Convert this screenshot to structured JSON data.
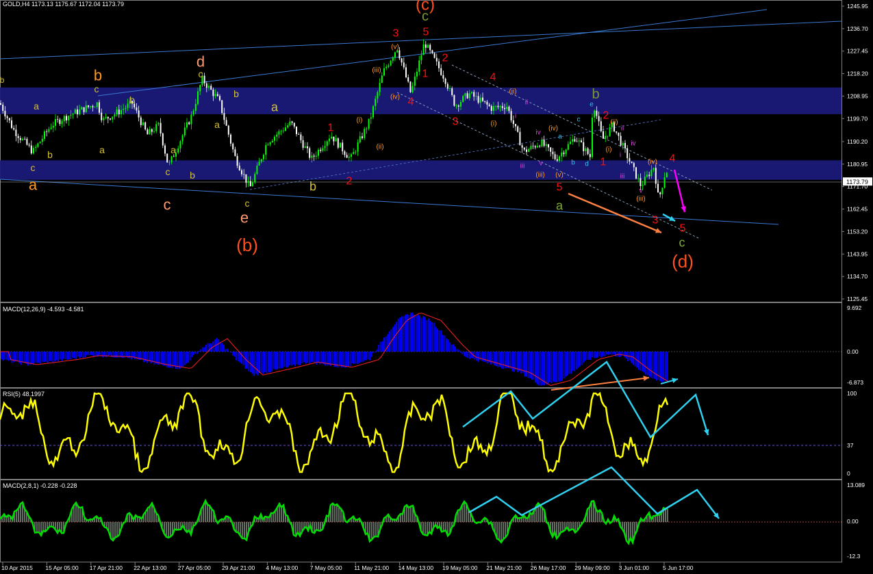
{
  "colors": {
    "background": "#000000",
    "bull_candle": "#00ff00",
    "bear_candle": "#ffffff",
    "zone": "#1a1a7a",
    "channel": "#3a7bd5",
    "macd_hist": "#0000ff",
    "macd_signal": "#ff2020",
    "rsi_line": "#ffff00",
    "macd2_line": "#00dd00",
    "macd2_hist": "#7a8a7a",
    "cyan": "#30d0f0",
    "orange": "#ff8040",
    "magenta": "#ff00ff",
    "level": "#6a5acd"
  },
  "main": {
    "title": "GOLD,H4  1173.13  1175.67  1172.04  1173.79",
    "current_price": "1173.79",
    "price_ticks": [
      "1245.95",
      "1236.70",
      "1227.45",
      "1218.20",
      "1208.95",
      "1199.70",
      "1190.20",
      "1180.95",
      "1171.70",
      "1162.45",
      "1153.20",
      "1143.95",
      "1134.70",
      "1125.45"
    ]
  },
  "macd1": {
    "title": "MACD(12,26,9) -4.593 -4.581",
    "ticks": [
      "9.692",
      "0.00",
      "-6.873"
    ]
  },
  "rsi": {
    "title": "RSI(5) 48.1997",
    "ticks": [
      "100",
      "37",
      "0"
    ]
  },
  "macd2": {
    "title": "MACD(2,8,1) -0.228 -0.228",
    "ticks": [
      "13.089",
      "0.00",
      "-12.3"
    ]
  },
  "time_labels": [
    "10 Apr 2015",
    "15 Apr 05:00",
    "17 Apr 21:00",
    "22 Apr 13:00",
    "27 Apr 05:00",
    "29 Apr 21:00",
    "4 May 13:00",
    "7 May 05:00",
    "11 May 21:00",
    "14 May 13:00",
    "19 May 05:00",
    "21 May 21:00",
    "26 May 17:00",
    "29 May 09:00",
    "3 Jun 01:00",
    "5 Jun 17:00"
  ],
  "chart_data": {
    "type": "line",
    "symbol": "GOLD",
    "timeframe": "H4",
    "ylim": [
      1125.45,
      1245.95
    ],
    "x": [
      "10 Apr 2015",
      "15 Apr 05:00",
      "17 Apr 21:00",
      "22 Apr 13:00",
      "27 Apr 05:00",
      "29 Apr 21:00",
      "4 May 13:00",
      "7 May 05:00",
      "11 May 21:00",
      "14 May 13:00",
      "19 May 05:00",
      "21 May 21:00",
      "26 May 17:00",
      "29 May 09:00",
      "3 Jun 01:00",
      "5 Jun 17:00"
    ],
    "close_approx": [
      1207,
      1199,
      1208,
      1181,
      1213,
      1181,
      1196,
      1189,
      1215,
      1226,
      1205,
      1199,
      1185,
      1190,
      1177,
      1173.79
    ],
    "ohlc_last": {
      "open": 1173.13,
      "high": 1175.67,
      "low": 1172.04,
      "close": 1173.79
    },
    "zones": [
      [
        1201.5,
        1212.5
      ],
      [
        1174.5,
        1182.5
      ]
    ],
    "wave_labels": [
      {
        "t": "b",
        "c": "#d4c030",
        "x": 3,
        "y": 117,
        "s": 12
      },
      {
        "t": "b",
        "c": "#ff9a20",
        "x": 143,
        "y": 110,
        "s": 22
      },
      {
        "t": "c",
        "c": "#d4c030",
        "x": 141,
        "y": 130,
        "s": 14
      },
      {
        "t": "a",
        "c": "#d4c030",
        "x": 53,
        "y": 155,
        "s": 14
      },
      {
        "t": "c",
        "c": "#d4c030",
        "x": 48,
        "y": 245,
        "s": 14
      },
      {
        "t": "b",
        "c": "#d4c030",
        "x": 73,
        "y": 226,
        "s": 14
      },
      {
        "t": "a",
        "c": "#ff9a20",
        "x": 48,
        "y": 270,
        "s": 22
      },
      {
        "t": "a",
        "c": "#d4c030",
        "x": 149,
        "y": 219,
        "s": 14
      },
      {
        "t": "b",
        "c": "#d4c030",
        "x": 193,
        "y": 146,
        "s": 14
      },
      {
        "t": "a",
        "c": "#d4c030",
        "x": 253,
        "y": 219,
        "s": 14
      },
      {
        "t": "c",
        "c": "#d4c030",
        "x": 245,
        "y": 251,
        "s": 14
      },
      {
        "t": "b",
        "c": "#d4c030",
        "x": 281,
        "y": 256,
        "s": 14
      },
      {
        "t": "c",
        "c": "#ff9a70",
        "x": 244,
        "y": 299,
        "s": 22
      },
      {
        "t": "d",
        "c": "#ff9a70",
        "x": 293,
        "y": 90,
        "s": 22
      },
      {
        "t": "c",
        "c": "#d4c030",
        "x": 293,
        "y": 108,
        "s": 14
      },
      {
        "t": "a",
        "c": "#d4c030",
        "x": 317,
        "y": 182,
        "s": 14
      },
      {
        "t": "b",
        "c": "#d4c030",
        "x": 345,
        "y": 137,
        "s": 14
      },
      {
        "t": "c",
        "c": "#d4c030",
        "x": 361,
        "y": 297,
        "s": 14
      },
      {
        "t": "e",
        "c": "#ff9a70",
        "x": 357,
        "y": 318,
        "s": 22
      },
      {
        "t": "(b)",
        "c": "#ff5020",
        "x": 361,
        "y": 358,
        "s": 26
      },
      {
        "t": "a",
        "c": "#d4c030",
        "x": 401,
        "y": 156,
        "s": 18
      },
      {
        "t": "b",
        "c": "#d4c030",
        "x": 457,
        "y": 272,
        "s": 18
      },
      {
        "t": "1",
        "c": "#ff1010",
        "x": 483,
        "y": 186,
        "s": 16
      },
      {
        "t": "2",
        "c": "#ff1010",
        "x": 510,
        "y": 264,
        "s": 16
      },
      {
        "t": "(i)",
        "c": "#ff9a20",
        "x": 525,
        "y": 175,
        "s": 10
      },
      {
        "t": "(ii)",
        "c": "#ff9a20",
        "x": 555,
        "y": 214,
        "s": 10
      },
      {
        "t": "(iii)",
        "c": "#ff9a20",
        "x": 550,
        "y": 102,
        "s": 10
      },
      {
        "t": "(iv)",
        "c": "#ff9a20",
        "x": 577,
        "y": 141,
        "s": 10
      },
      {
        "t": "(v)",
        "c": "#ff9a20",
        "x": 577,
        "y": 68,
        "s": 10
      },
      {
        "t": "3",
        "c": "#ff1010",
        "x": 578,
        "y": 48,
        "s": 16
      },
      {
        "t": "4",
        "c": "#ff1010",
        "x": 600,
        "y": 148,
        "s": 16
      },
      {
        "t": "5",
        "c": "#ff1010",
        "x": 622,
        "y": 46,
        "s": 16
      },
      {
        "t": "1",
        "c": "#ff1010",
        "x": 621,
        "y": 107,
        "s": 16
      },
      {
        "t": "2",
        "c": "#ff1010",
        "x": 650,
        "y": 84,
        "s": 16
      },
      {
        "t": "(c)",
        "c": "#ff5020",
        "x": 621,
        "y": 6,
        "s": 24
      },
      {
        "t": "c",
        "c": "#7a9a30",
        "x": 621,
        "y": 23,
        "s": 20
      },
      {
        "t": "3",
        "c": "#ff1010",
        "x": 665,
        "y": 177,
        "s": 16
      },
      {
        "t": "4",
        "c": "#ff1010",
        "x": 720,
        "y": 112,
        "s": 16
      },
      {
        "t": "(ii)",
        "c": "#ff9a20",
        "x": 749,
        "y": 133,
        "s": 10
      },
      {
        "t": "(i)",
        "c": "#ff9a20",
        "x": 721,
        "y": 180,
        "s": 10
      },
      {
        "t": "i",
        "c": "#dd44dd",
        "x": 753,
        "y": 169,
        "s": 10
      },
      {
        "t": "ii",
        "c": "#dd44dd",
        "x": 769,
        "y": 149,
        "s": 10
      },
      {
        "t": "iv",
        "c": "#dd44dd",
        "x": 786,
        "y": 193,
        "s": 10
      },
      {
        "t": "iii",
        "c": "#dd44dd",
        "x": 763,
        "y": 242,
        "s": 10
      },
      {
        "t": "v",
        "c": "#dd44dd",
        "x": 790,
        "y": 238,
        "s": 10
      },
      {
        "t": "(iv)",
        "c": "#ff9a20",
        "x": 808,
        "y": 187,
        "s": 10
      },
      {
        "t": "(iii)",
        "c": "#ff9a20",
        "x": 789,
        "y": 255,
        "s": 10
      },
      {
        "t": "(v)",
        "c": "#ff9a20",
        "x": 817,
        "y": 255,
        "s": 10
      },
      {
        "t": "a",
        "c": "#30c0f0",
        "x": 818,
        "y": 199,
        "s": 10
      },
      {
        "t": "b",
        "c": "#30c0f0",
        "x": 837,
        "y": 237,
        "s": 10
      },
      {
        "t": "c",
        "c": "#30c0f0",
        "x": 845,
        "y": 174,
        "s": 10
      },
      {
        "t": "d",
        "c": "#30c0f0",
        "x": 857,
        "y": 239,
        "s": 10
      },
      {
        "t": "e",
        "c": "#30c0f0",
        "x": 864,
        "y": 152,
        "s": 10
      },
      {
        "t": "5",
        "c": "#ff1010",
        "x": 817,
        "y": 273,
        "s": 16
      },
      {
        "t": "a",
        "c": "#7ab030",
        "x": 817,
        "y": 300,
        "s": 18
      },
      {
        "t": "b",
        "c": "#7a9a30",
        "x": 870,
        "y": 137,
        "s": 20
      },
      {
        "t": "2",
        "c": "#ff1010",
        "x": 885,
        "y": 168,
        "s": 16
      },
      {
        "t": "1",
        "c": "#ff1010",
        "x": 881,
        "y": 236,
        "s": 16
      },
      {
        "t": "(ii)",
        "c": "#ff9a20",
        "x": 897,
        "y": 178,
        "s": 10
      },
      {
        "t": "(i)",
        "c": "#ff9a20",
        "x": 889,
        "y": 218,
        "s": 10
      },
      {
        "t": "ii",
        "c": "#dd44dd",
        "x": 909,
        "y": 187,
        "s": 10
      },
      {
        "t": "iv",
        "c": "#dd44dd",
        "x": 925,
        "y": 209,
        "s": 10
      },
      {
        "t": "i",
        "c": "#dd44dd",
        "x": 906,
        "y": 226,
        "s": 10
      },
      {
        "t": "iii",
        "c": "#dd44dd",
        "x": 909,
        "y": 257,
        "s": 10
      },
      {
        "t": "(iv)",
        "c": "#ff9a20",
        "x": 953,
        "y": 236,
        "s": 10
      },
      {
        "t": "v",
        "c": "#dd44dd",
        "x": 936,
        "y": 278,
        "s": 10
      },
      {
        "t": "(iii)",
        "c": "#ff9a20",
        "x": 936,
        "y": 290,
        "s": 10
      },
      {
        "t": "4",
        "c": "#ff1010",
        "x": 982,
        "y": 231,
        "s": 16
      },
      {
        "t": "3",
        "c": "#ff1010",
        "x": 957,
        "y": 321,
        "s": 16
      },
      {
        "t": "5",
        "c": "#ff1010",
        "x": 997,
        "y": 333,
        "s": 16
      },
      {
        "t": "c",
        "c": "#7ab030",
        "x": 996,
        "y": 354,
        "s": 18
      },
      {
        "t": "(d)",
        "c": "#ff5020",
        "x": 997,
        "y": 382,
        "s": 26
      }
    ]
  }
}
